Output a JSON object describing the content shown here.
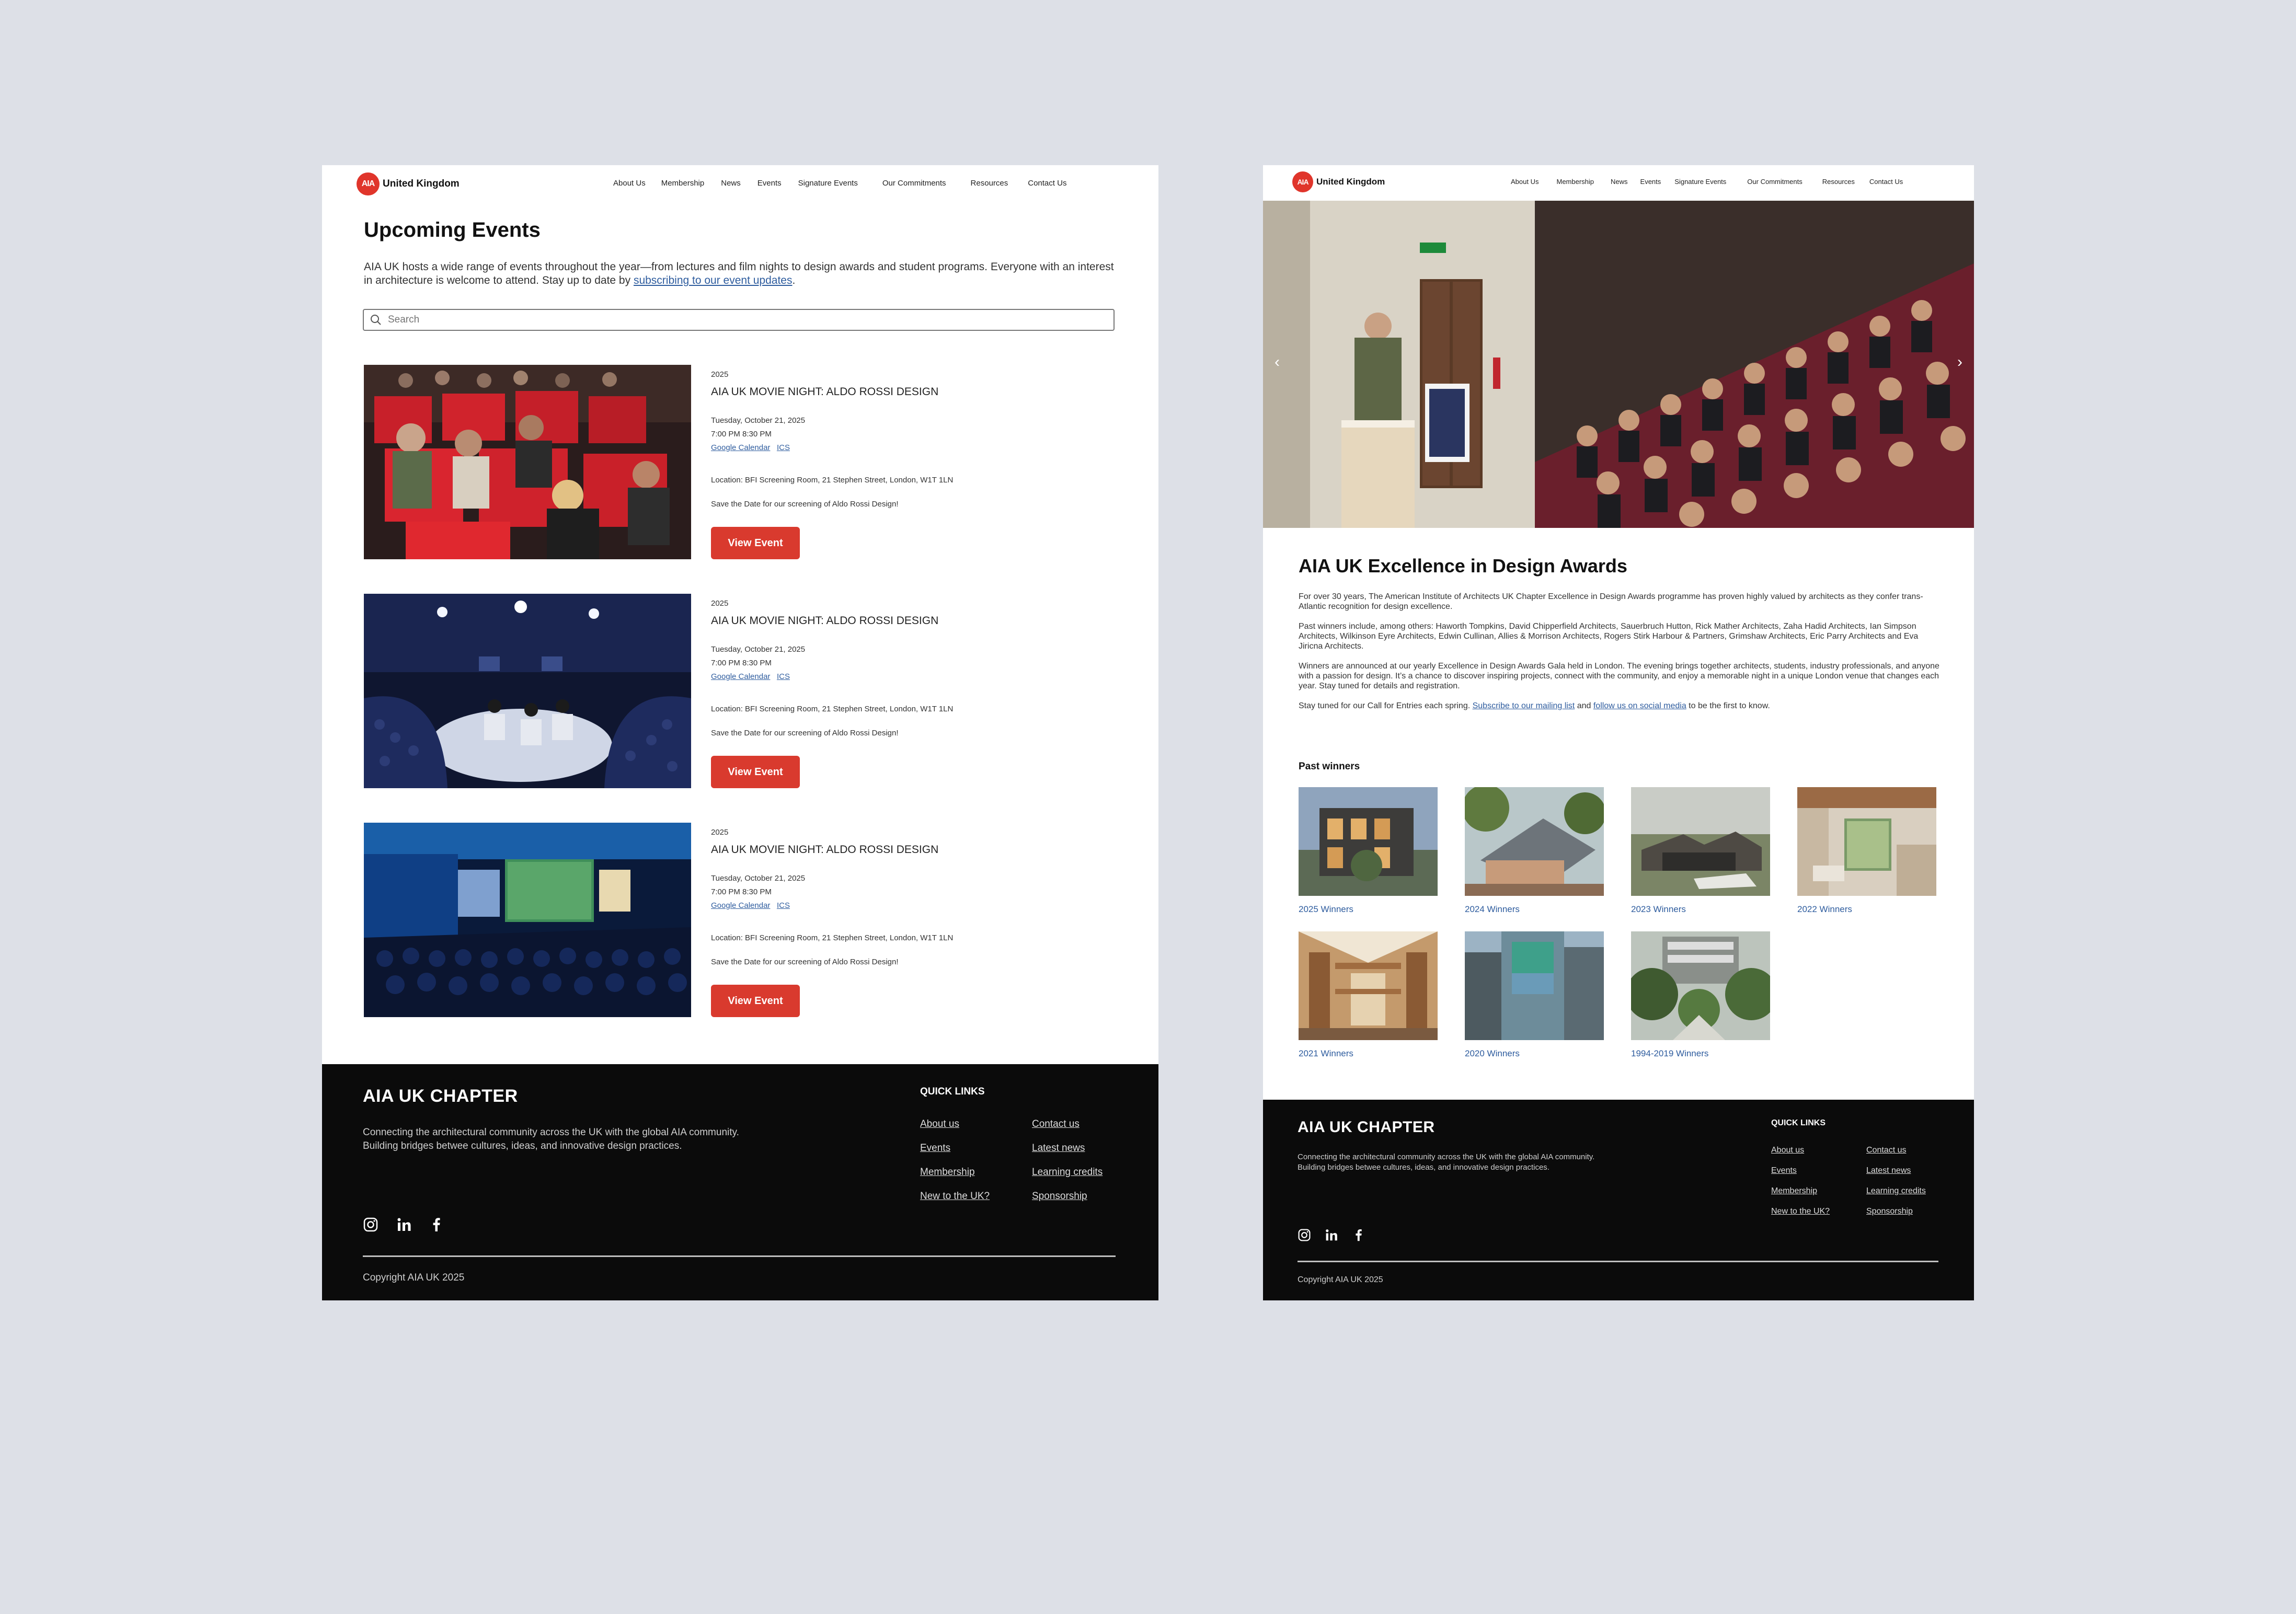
{
  "brand": {
    "logo_mark": "AIA",
    "name": "United Kingdom",
    "accent": "#e0352b",
    "button_color": "#d93a2e",
    "link_color": "#2e5c9e"
  },
  "nav": [
    "About Us",
    "Membership",
    "News",
    "Events",
    "Signature Events",
    "Our Commitments",
    "Resources",
    "Contact Us"
  ],
  "events_page": {
    "title": "Upcoming Events",
    "intro_text": "AIA UK hosts a wide range of events throughout the year—from lectures and film nights to design awards and student programs. Everyone with an interest in architecture is welcome to attend. Stay up to date by ",
    "intro_link": "subscribing to our event updates",
    "intro_end": ".",
    "search_placeholder": "Search",
    "events": [
      {
        "year": "2025",
        "title": "AIA UK MOVIE NIGHT: ALDO ROSSI DESIGN",
        "date": "Tuesday, October 21, 2025",
        "time": "7:00 PM  8:30 PM",
        "gcal": "Google Calendar",
        "ics": "ICS",
        "location": "Location: BFI Screening Room, 21 Stephen Street, London, W1T 1LN",
        "note": "Save the Date for our screening of Aldo Rossi Design!",
        "button": "View Event"
      },
      {
        "year": "2025",
        "title": "AIA UK MOVIE NIGHT: ALDO ROSSI DESIGN",
        "date": "Tuesday, October 21, 2025",
        "time": "7:00 PM  8:30 PM",
        "gcal": "Google Calendar",
        "ics": "ICS",
        "location": "Location: BFI Screening Room, 21 Stephen Street, London, W1T 1LN",
        "note": "Save the Date for our screening of Aldo Rossi Design!",
        "button": "View Event"
      },
      {
        "year": "2025",
        "title": "AIA UK MOVIE NIGHT: ALDO ROSSI DESIGN",
        "date": "Tuesday, October 21, 2025",
        "time": "7:00 PM  8:30 PM",
        "gcal": "Google Calendar",
        "ics": "ICS",
        "location": "Location: BFI Screening Room, 21 Stephen Street, London, W1T 1LN",
        "note": "Save the Date for our screening of Aldo Rossi Design!",
        "button": "View Event"
      }
    ]
  },
  "awards_page": {
    "title": "AIA UK Excellence in Design Awards",
    "p1": "For over 30 years, The American Institute of Architects UK Chapter Excellence in Design Awards programme has proven highly valued by architects as they confer trans-Atlantic recognition for design excellence.",
    "p2": "Past winners include, among others: Haworth Tompkins, David Chipperfield Architects, Sauerbruch Hutton, Rick Mather Architects, Zaha Hadid Architects, Ian Simpson Architects, Wilkinson Eyre Architects, Edwin Cullinan, Allies & Morrison Architects, Rogers Stirk Harbour & Partners, Grimshaw Architects, Eric Parry Architects and Eva Jiricna Architects.",
    "p3": "Winners are announced at our yearly Excellence in Design Awards Gala held in London. The evening brings together architects, students, industry professionals, and anyone with a passion for design. It’s a chance to discover inspiring projects, connect with the community, and enjoy a memorable night in a unique London venue that changes each year. Stay tuned for details and registration.",
    "p4_start": "Stay tuned for our Call for Entries each spring. ",
    "p4_link1": "Subscribe to our mailing list",
    "p4_mid": " and ",
    "p4_link2": "follow us on social media",
    "p4_end": " to be the first to know.",
    "past_winners_heading": "Past winners",
    "winners": [
      "2025 Winners",
      "2024 Winners",
      "2023 Winners",
      "2022 Winners",
      "2021 Winners",
      "2020 Winners",
      "1994-2019 Winners"
    ]
  },
  "footer": {
    "title": "AIA UK CHAPTER",
    "desc1": "Connecting the architectural community across the UK with the global AIA community.",
    "desc2": "Building bridges betwee cultures, ideas, and innovative  design practices.",
    "quick_links_heading": "QUICK LINKS",
    "links_col1": [
      "About us",
      "Events",
      "Membership",
      "New to the UK?"
    ],
    "links_col2": [
      "Contact us",
      "Latest news",
      "Learning credits",
      "Sponsorship"
    ],
    "copyright": "Copyright AIA UK 2025",
    "social_icons": [
      "instagram-icon",
      "linkedin-icon",
      "facebook-icon"
    ]
  }
}
